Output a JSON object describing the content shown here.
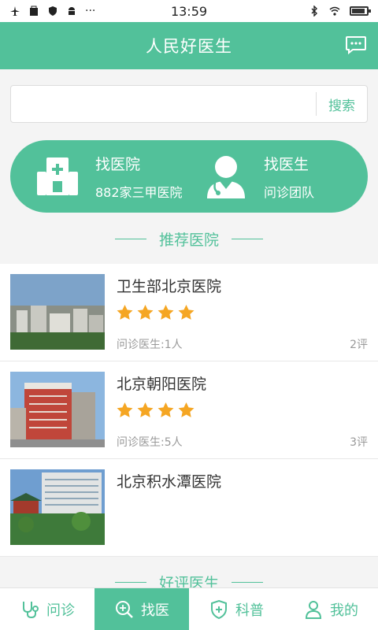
{
  "status_bar": {
    "time": "13:59"
  },
  "header": {
    "title": "人民好医生",
    "message_icon": "chat-bubble-icon"
  },
  "search": {
    "value": "",
    "placeholder": "",
    "button_label": "搜索"
  },
  "banner": {
    "left": {
      "title": "找医院",
      "subtitle": "882家三甲医院",
      "icon": "hospital-icon"
    },
    "right": {
      "title": "找医生",
      "subtitle": "问诊团队",
      "icon": "doctor-icon"
    }
  },
  "recommended": {
    "section_title": "推荐医院",
    "hospitals": [
      {
        "name": "卫生部北京医院",
        "stars": 4,
        "doctors": "问诊医生:1人",
        "reviews": "2评"
      },
      {
        "name": "北京朝阳医院",
        "stars": 4,
        "doctors": "问诊医生:5人",
        "reviews": "3评"
      },
      {
        "name": "北京积水潭医院"
      }
    ]
  },
  "good_doctors": {
    "section_title": "好评医生"
  },
  "bottom_nav": [
    {
      "label": "问诊",
      "icon": "stethoscope-icon",
      "active": false
    },
    {
      "label": "找医",
      "icon": "search-plus-icon",
      "active": true
    },
    {
      "label": "科普",
      "icon": "shield-plus-icon",
      "active": false
    },
    {
      "label": "我的",
      "icon": "person-icon",
      "active": false
    }
  ],
  "colors": {
    "brand": "#52c19a",
    "star": "#f5a623"
  }
}
